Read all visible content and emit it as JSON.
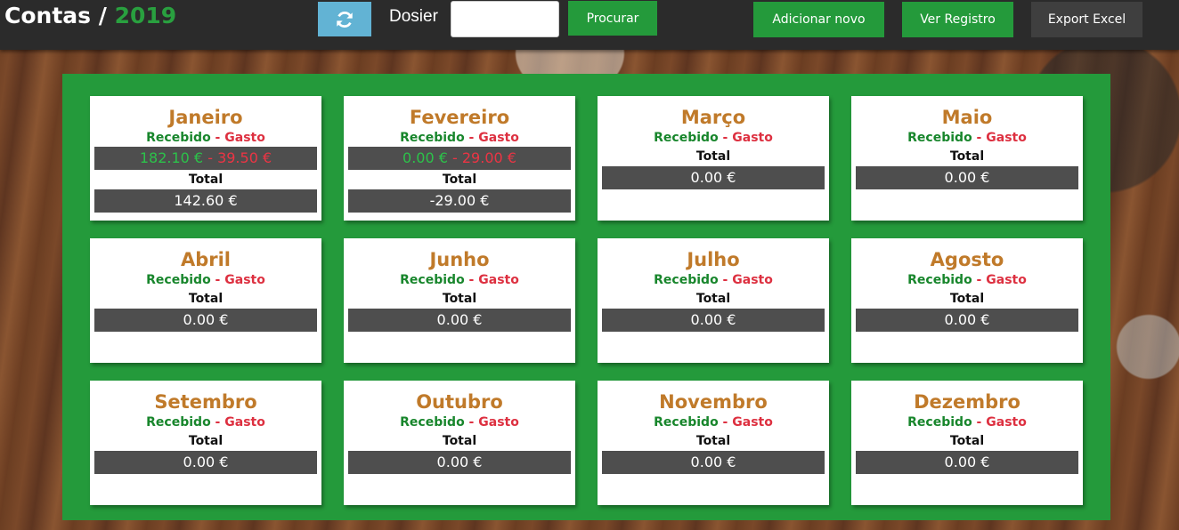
{
  "header": {
    "title": "Contas / ",
    "year": "2019",
    "dosier_label": "Dosier",
    "dosier_value": "",
    "search_label": "Procurar",
    "add_label": "Adicionar novo",
    "view_label": "Ver Registro",
    "export_label": "Export Excel"
  },
  "legend": {
    "received": "Recebido",
    "separator": " - ",
    "spent": "Gasto",
    "total": "Total"
  },
  "months": [
    {
      "name": "Janeiro",
      "received": "182.10 €",
      "spent": "39.50 €",
      "total": "142.60 €"
    },
    {
      "name": "Fevereiro",
      "received": "0.00 €",
      "spent": "29.00 €",
      "total": "-29.00 €"
    },
    {
      "name": "Março",
      "total": "0.00 €"
    },
    {
      "name": "Maio",
      "total": "0.00 €"
    },
    {
      "name": "Abril",
      "total": "0.00 €"
    },
    {
      "name": "Junho",
      "total": "0.00 €"
    },
    {
      "name": "Julho",
      "total": "0.00 €"
    },
    {
      "name": "Agosto",
      "total": "0.00 €"
    },
    {
      "name": "Setembro",
      "total": "0.00 €"
    },
    {
      "name": "Outubro",
      "total": "0.00 €"
    },
    {
      "name": "Novembro",
      "total": "0.00 €"
    },
    {
      "name": "Dezembro",
      "total": "0.00 €"
    }
  ],
  "colors": {
    "accent_green": "#249a3b",
    "month_title": "#c07a2a",
    "received": "#18862c",
    "spent": "#dd3040",
    "refresh_button": "#62b3d4"
  },
  "icons": {
    "refresh": "refresh-icon"
  }
}
